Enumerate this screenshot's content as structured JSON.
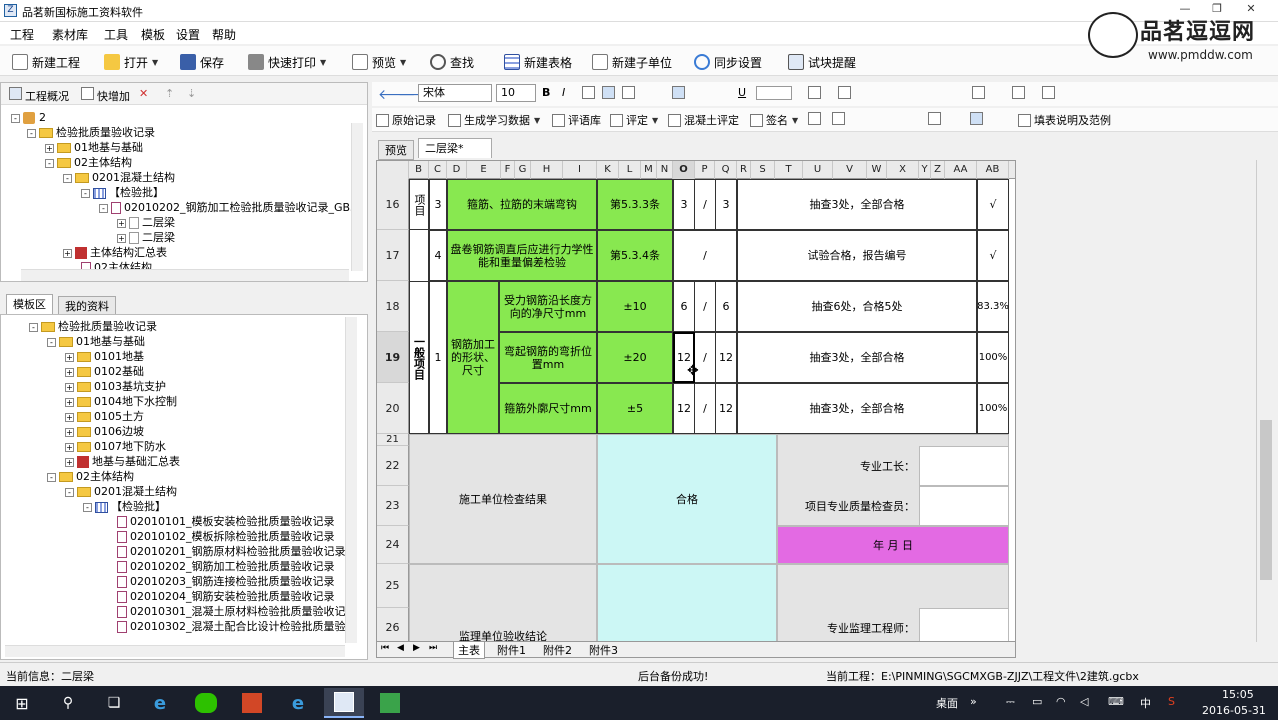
{
  "window": {
    "title": "品茗新国标施工资料软件"
  },
  "menu": [
    "工程",
    "素材库",
    "工具",
    "模板",
    "设置",
    "帮助"
  ],
  "toolbar": {
    "new_project": "新建工程",
    "open": "打开",
    "save": "保存",
    "quick_print": "快速打印",
    "preview": "预览",
    "find": "查找",
    "new_table": "新建表格",
    "new_subunit": "新建子单位",
    "sync_settings": "同步设置",
    "test_reminder": "试块提醒"
  },
  "brand": {
    "name": "品茗逗逗网",
    "url": "www.pmddw.com"
  },
  "left_top": {
    "tabs": [
      "工程概况",
      "快增加"
    ],
    "tree": [
      {
        "label": "2"
      },
      {
        "label": "检验批质量验收记录"
      },
      {
        "label": "01地基与基础"
      },
      {
        "label": "02主体结构"
      },
      {
        "label": "0201混凝土结构"
      },
      {
        "label": "【检验批】"
      },
      {
        "label": "02010202_钢筋加工检验批质量验收记录_GB5"
      },
      {
        "label": "二层梁"
      },
      {
        "label": "二层梁"
      },
      {
        "label": "主体结构汇总表"
      },
      {
        "label": "02主体结构"
      }
    ]
  },
  "left_bottom": {
    "tabs": [
      "模板区",
      "我的资料"
    ],
    "tree": [
      {
        "label": "检验批质量验收记录"
      },
      {
        "label": "01地基与基础"
      },
      {
        "label": "0101地基"
      },
      {
        "label": "0102基础"
      },
      {
        "label": "0103基坑支护"
      },
      {
        "label": "0104地下水控制"
      },
      {
        "label": "0105土方"
      },
      {
        "label": "0106边坡"
      },
      {
        "label": "0107地下防水"
      },
      {
        "label": "地基与基础汇总表"
      },
      {
        "label": "02主体结构"
      },
      {
        "label": "0201混凝土结构"
      },
      {
        "label": "【检验批】"
      },
      {
        "label": "02010101_模板安装检验批质量验收记录"
      },
      {
        "label": "02010102_模板拆除检验批质量验收记录"
      },
      {
        "label": "02010201_钢筋原材料检验批质量验收记录"
      },
      {
        "label": "02010202_钢筋加工检验批质量验收记录"
      },
      {
        "label": "02010203_钢筋连接检验批质量验收记录"
      },
      {
        "label": "02010204_钢筋安装检验批质量验收记录"
      },
      {
        "label": "02010301_混凝土原材料检验批质量验收记"
      },
      {
        "label": "02010302_混凝土配合比设计检验批质量验"
      }
    ]
  },
  "format_bar": {
    "font": "宋体",
    "size": "10"
  },
  "action_bar": {
    "original": "原始记录",
    "gen_data": "生成学习数据",
    "eval_lib": "评语库",
    "evaluate": "评定",
    "concrete_eval": "混凝土评定",
    "sign": "签名",
    "fill_help": "填表说明及范例"
  },
  "doc_tabs": [
    "预览",
    "二层梁*"
  ],
  "columns": [
    "B",
    "C",
    "D",
    "E",
    "F",
    "G",
    "H",
    "I",
    "K",
    "L",
    "M",
    "N",
    "O",
    "P",
    "Q",
    "R",
    "S",
    "T",
    "U",
    "V",
    "W",
    "X",
    "Y",
    "Z",
    "AA",
    "AB"
  ],
  "rows": {
    "r16": {
      "num": "16",
      "sub": "3",
      "item": "箍筋、拉筋的末端弯钩",
      "clause": "第5.3.3条",
      "a": "3",
      "slash": "/",
      "b": "3",
      "result": "抽查3处，全部合格",
      "mark": "√"
    },
    "r17": {
      "num": "17",
      "sub": "4",
      "item": "盘卷钢筋调直后应进行力学性能和重量偏差检验",
      "clause": "第5.3.4条",
      "slash": "/",
      "result": "试验合格，报告编号",
      "mark": "√"
    },
    "r18": {
      "num": "18",
      "detail": "受力钢筋沿长度方向的净尺寸mm",
      "tol": "±10",
      "a": "6",
      "slash": "/",
      "b": "6",
      "result": "抽查6处，合格5处",
      "mark": "83.3%"
    },
    "r19": {
      "num": "19",
      "detail": "弯起钢筋的弯折位置mm",
      "tol": "±20",
      "a": "12",
      "slash": "/",
      "b": "12",
      "result": "抽查3处，全部合格",
      "mark": "100%"
    },
    "r20": {
      "num": "20",
      "detail": "箍筋外廓尺寸mm",
      "tol": "±5",
      "a": "12",
      "slash": "/",
      "b": "12",
      "result": "抽查3处，全部合格",
      "mark": "100%"
    },
    "general": "一般项目",
    "main_item": "项目",
    "group_no": "1",
    "group_name": "钢筋加工的形状、尺寸",
    "r21": "21",
    "r22": "22",
    "r23": "23",
    "r24": "24",
    "r25": "25",
    "r26": "26",
    "constr_check": "施工单位检查结果",
    "qualified": "合格",
    "foreman": "专业工长：",
    "inspector": "项目专业质量检查员：",
    "date": "年  月  日",
    "supervisor_check": "监理单位验收结论",
    "supervisor": "专业监理工程师："
  },
  "sheet_tabs": [
    "主表",
    "附件1",
    "附件2",
    "附件3"
  ],
  "status": {
    "current_info": "当前信息：二层梁",
    "backup": "后台备份成功!",
    "current_project": "当前工程：E:\\PINMING\\SGCMXGB-ZJJZ\\工程文件\\2建筑.gcbx"
  },
  "taskbar": {
    "desktop": "桌面",
    "ime": "中",
    "time": "15:05",
    "date": "2016-05-31"
  },
  "colors": {
    "green": "#88e850",
    "cyan": "#ccf7f5",
    "magenta": "#e36ae3",
    "gray": "#e4e4e4",
    "selection": "#3399ff"
  }
}
